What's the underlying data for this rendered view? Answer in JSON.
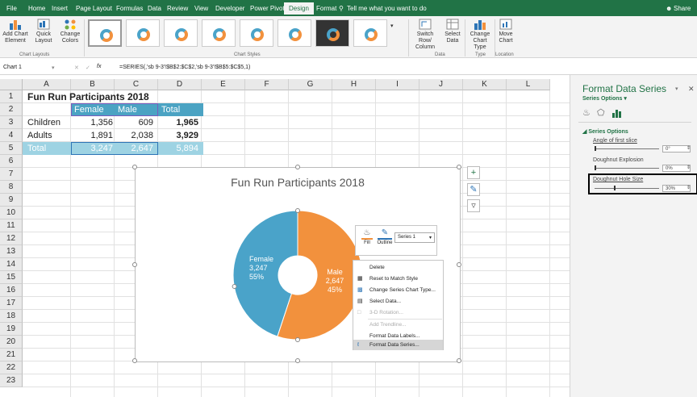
{
  "ribbon_tabs": [
    "File",
    "Home",
    "Insert",
    "Page Layout",
    "Formulas",
    "Data",
    "Review",
    "View",
    "Developer",
    "Power Pivot",
    "Design",
    "Format"
  ],
  "tell_me": "Tell me what you want to do",
  "share": "Share",
  "ribbon": {
    "add_chart_element": "Add Chart Element",
    "quick_layout": "Quick Layout",
    "change_colors": "Change Colors",
    "chart_layouts": "Chart Layouts",
    "chart_styles": "Chart Styles",
    "switch_row_column": "Switch Row/ Column",
    "select_data": "Select Data",
    "data_group": "Data",
    "change_chart_type": "Change Chart Type",
    "type_group": "Type",
    "move_chart": "Move Chart",
    "location_group": "Location"
  },
  "name_box": "Chart 1",
  "formula": "=SERIES(,'sb 9-3'!$B$2:$C$2,'sb 9-3'!$B$5:$C$5,1)",
  "columns": [
    "A",
    "B",
    "C",
    "D",
    "E",
    "F",
    "G",
    "H",
    "I",
    "J",
    "K",
    "L"
  ],
  "rows": [
    "1",
    "2",
    "3",
    "4",
    "5",
    "6",
    "7",
    "8",
    "9",
    "10",
    "11",
    "12",
    "13",
    "14",
    "15",
    "16",
    "17",
    "18",
    "19",
    "20",
    "21",
    "22",
    "23"
  ],
  "sheet": {
    "title": "Fun Run Participants 2018",
    "header": [
      "Female",
      "Male",
      "Total"
    ],
    "rows": [
      {
        "label": "Children",
        "female": "1,356",
        "male": "609",
        "total": "1,965"
      },
      {
        "label": "Adults",
        "female": "1,891",
        "male": "2,038",
        "total": "3,929"
      },
      {
        "label": "Total",
        "female": "3,247",
        "male": "2,647",
        "total": "5,894"
      }
    ]
  },
  "chart_data": {
    "type": "pie",
    "title": "Fun Run Participants 2018",
    "series": [
      {
        "name": "Male",
        "value": 2647,
        "percent": "45%",
        "color": "#4aa3c9"
      },
      {
        "name": "Female",
        "value": 3247,
        "percent": "55%",
        "color": "#f2913d"
      }
    ],
    "hole_size_percent": 30
  },
  "mini_toolbar": {
    "fill": "Fill",
    "outline": "Outline",
    "series": "Series 1"
  },
  "context_menu": [
    {
      "label": "Delete",
      "disabled": false
    },
    {
      "label": "Reset to Match Style",
      "disabled": false
    },
    {
      "label": "Change Series Chart Type...",
      "disabled": false
    },
    {
      "label": "Select Data...",
      "disabled": false
    },
    {
      "label": "3-D Rotation...",
      "disabled": true
    },
    {
      "label": "Add Trendline...",
      "disabled": true
    },
    {
      "label": "Format Data Labels...",
      "disabled": false
    },
    {
      "label": "Format Data Series...",
      "disabled": false
    }
  ],
  "pane": {
    "title": "Format Data Series",
    "subtitle": "Series Options",
    "section": "Series Options",
    "angle_label": "Angle of first slice",
    "angle_value": "0°",
    "explosion_label": "Doughnut Explosion",
    "explosion_value": "0%",
    "hole_label": "Doughnut Hole Size",
    "hole_value": "30%"
  },
  "colors": {
    "excel_green": "#217346",
    "header_teal": "#4ba3c3",
    "male": "#4aa3c9",
    "female": "#f2913d"
  }
}
